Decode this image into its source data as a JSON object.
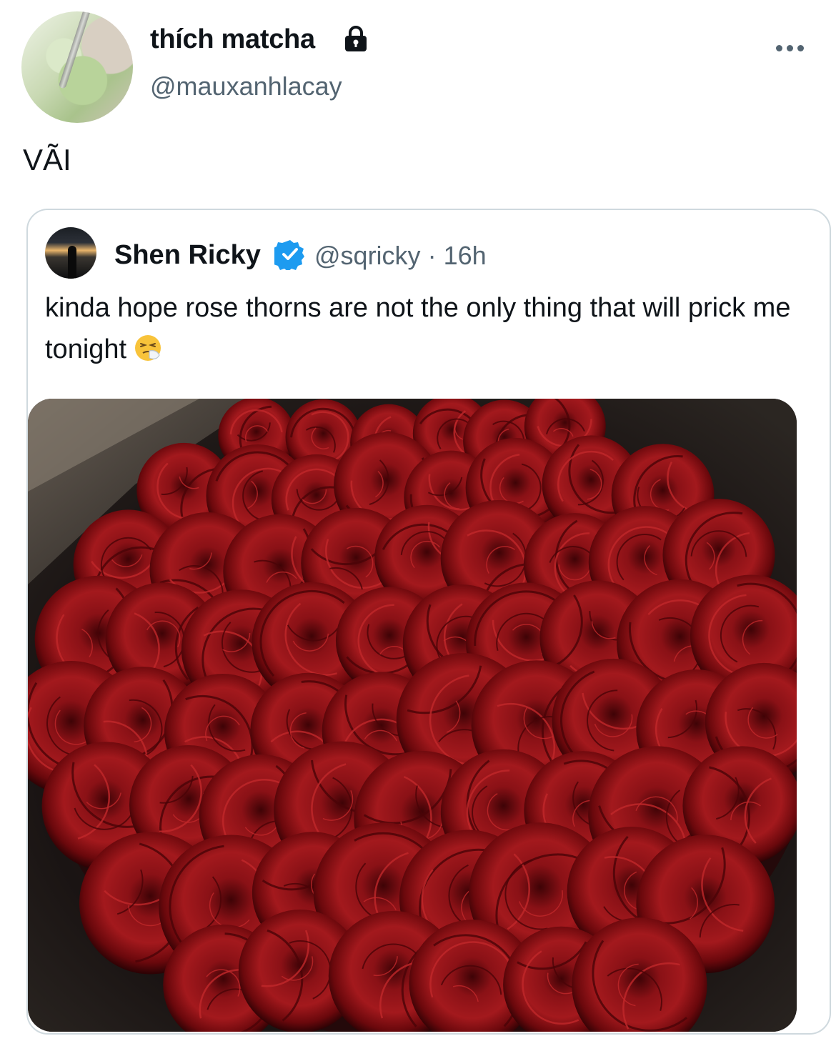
{
  "author": {
    "display_name": "thích matcha",
    "handle": "@mauxanhlacay",
    "avatar_icon": "matcha-drink-avatar",
    "protected_icon": "lock-icon"
  },
  "tweet": {
    "text": "VÃI",
    "more_icon": "more-options-icon"
  },
  "quoted_tweet": {
    "display_name": "Shen Ricky",
    "verified_icon": "verified-badge-icon",
    "handle": "@sqricky",
    "separator": "·",
    "time": "16h",
    "text": "kinda hope rose thorns are not the only thing that will prick me tonight",
    "emoji": "sneezing-face-emoji",
    "media_subject": "red-roses-bouquet-photo"
  },
  "colors": {
    "text_primary": "#0f1419",
    "text_secondary": "#536471",
    "border": "#cfd9de",
    "verified_blue": "#1d9bf0",
    "rose_red": "#7a0f12"
  }
}
